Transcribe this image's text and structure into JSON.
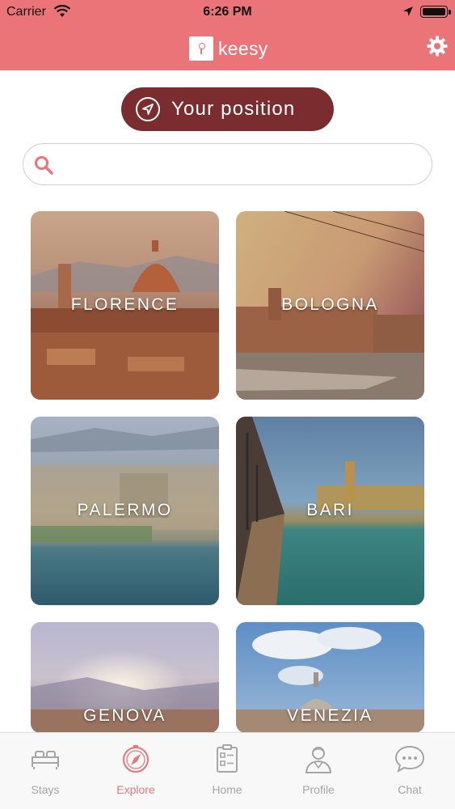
{
  "status_bar": {
    "carrier": "Carrier",
    "time": "6:26 PM"
  },
  "header": {
    "logo_text": "keesy",
    "settings_icon": "gear-icon",
    "color": "#eb7479"
  },
  "position_button": {
    "label": "Your position",
    "icon": "navigation-arrow-icon",
    "color": "#7a2c2e"
  },
  "search": {
    "placeholder": "",
    "value": ""
  },
  "cities": [
    {
      "name": "FLORENCE"
    },
    {
      "name": "BOLOGNA"
    },
    {
      "name": "PALERMO"
    },
    {
      "name": "BARI"
    },
    {
      "name": "GENOVA"
    },
    {
      "name": "VENEZIA"
    }
  ],
  "tabs": [
    {
      "label": "Stays",
      "icon": "bed-icon",
      "active": false
    },
    {
      "label": "Explore",
      "icon": "compass-icon",
      "active": true
    },
    {
      "label": "Home",
      "icon": "checklist-icon",
      "active": false
    },
    {
      "label": "Profile",
      "icon": "person-icon",
      "active": false
    },
    {
      "label": "Chat",
      "icon": "chat-bubble-icon",
      "active": false
    }
  ]
}
